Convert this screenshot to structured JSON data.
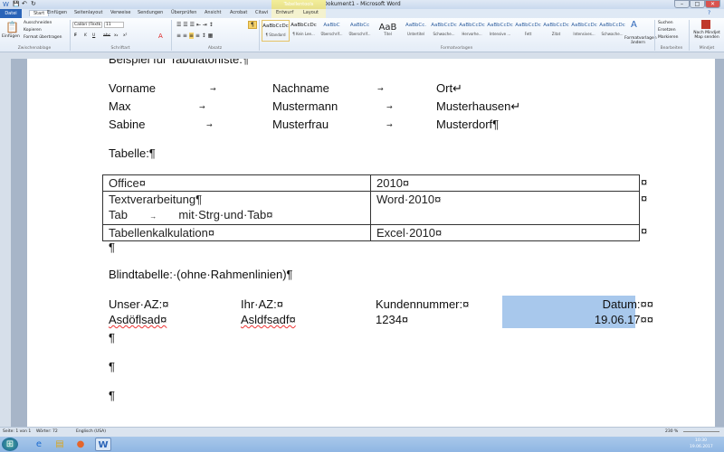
{
  "window": {
    "title": "Dokument1 - Microsoft Word",
    "context_tab": "Tabellentools",
    "buttons": [
      "–",
      "□",
      "✕"
    ]
  },
  "tabs": [
    "Datei",
    "Start",
    "Einfügen",
    "Seitenlayout",
    "Verweise",
    "Sendungen",
    "Überprüfen",
    "Ansicht",
    "Acrobat",
    "Citavi",
    "Entwurf",
    "Layout"
  ],
  "ribbon": {
    "clipboard": {
      "paste": "Einfügen",
      "cut": "Ausschneiden",
      "copy": "Kopieren",
      "format_painter": "Format übertragen",
      "group": "Zwischenablage"
    },
    "font": {
      "name": "Calibri (Textk",
      "size": "11",
      "group": "Schriftart",
      "buttons": [
        "F",
        "K",
        "U",
        "abc",
        "x₂",
        "x²"
      ]
    },
    "paragraph": {
      "group": "Absatz"
    },
    "styles": {
      "group": "Formatvorlagen",
      "items": [
        {
          "sample": "AaBbCcDc",
          "label": "¶ Standard"
        },
        {
          "sample": "AaBbCcDc",
          "label": "¶ Kein Lee..."
        },
        {
          "sample": "AaBbC",
          "label": "Überschrif..."
        },
        {
          "sample": "AaBbCc",
          "label": "Überschrif..."
        },
        {
          "sample": "AaB",
          "label": "Titel"
        },
        {
          "sample": "AaBbCc.",
          "label": "Untertitel"
        },
        {
          "sample": "AaBbCcDc",
          "label": "Schwache..."
        },
        {
          "sample": "AaBbCcDc",
          "label": "Hervorhe..."
        },
        {
          "sample": "AaBbCcDc",
          "label": "Intensive ..."
        },
        {
          "sample": "AaBbCcDc",
          "label": "Fett"
        },
        {
          "sample": "AaBbCcDc",
          "label": "Zitat"
        },
        {
          "sample": "AaBbCcDc",
          "label": "Intensives..."
        },
        {
          "sample": "AaBbCcDc",
          "label": "Schwache..."
        }
      ],
      "change": "Formatvorlagen ändern"
    },
    "editing": {
      "find": "Suchen",
      "replace": "Ersetzen",
      "select": "Markieren",
      "group": "Bearbeiten"
    },
    "mindjet": {
      "send": "Nach Mindjet Map senden",
      "group": "Mindjet"
    }
  },
  "document": {
    "heading": "Beispiel für Tabulatorliste:¶",
    "tab_rows": [
      [
        "Vorname",
        "Nachname",
        "Ort↵"
      ],
      [
        "Max",
        "Mustermann",
        "Musterhausen↵"
      ],
      [
        "Sabine",
        "Musterfrau",
        "Musterdorf¶"
      ]
    ],
    "table_label": "Tabelle:¶",
    "table": [
      [
        "Office¤",
        "2010¤"
      ],
      [
        "Textverarbeitung¶\nTab → mit·Strg·und·Tab¤",
        "Word·2010¤"
      ],
      [
        "Tabellenkalkulation¤",
        "Excel·2010¤"
      ]
    ],
    "table_line2": [
      "Tab",
      "mit·Strg·und·Tab¤"
    ],
    "end_mark": "¤",
    "para": "¶",
    "blind_label": "Blindtabelle:·(ohne·Rahmenlinien)¶",
    "blind": [
      [
        "Unser·AZ:¤",
        "Ihr·AZ:¤",
        "Kundennummer:¤",
        "Datum:¤¤"
      ],
      [
        "Asdöflsad¤",
        "Asldfsadf¤",
        "1234¤",
        "19.06.17¤¤"
      ]
    ]
  },
  "status": {
    "page": "Seite: 1 von 1",
    "words": "Wörter: 72",
    "language": "Englisch (USA)",
    "zoom": "230 %"
  },
  "taskbar": {
    "time": "10:30",
    "date": "19.06.2017"
  },
  "colors": {
    "accent": "#2a64b8",
    "selection": "#a8c8ec"
  }
}
